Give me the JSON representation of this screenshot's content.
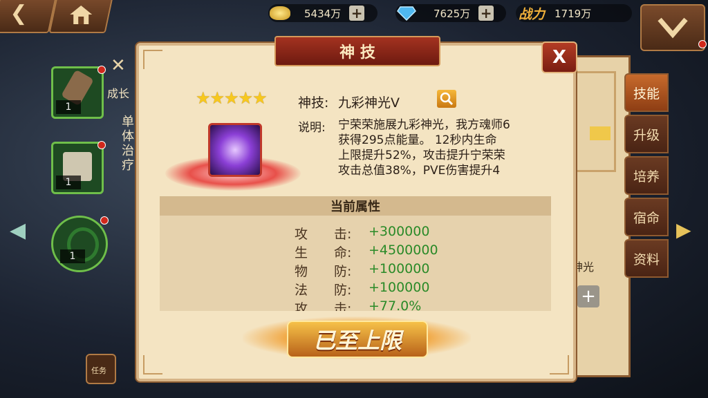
{
  "topbar": {
    "back_icon": "back-arrow-icon",
    "home_icon": "home-icon",
    "gold": {
      "icon": "gold-ingot-icon",
      "value": "5434万",
      "plus": "+"
    },
    "diamond": {
      "icon": "diamond-icon",
      "value": "7625万",
      "plus": "+"
    },
    "power": {
      "label": "战力",
      "value": "1719万"
    },
    "menu_icon": "chevron-down-menu-icon"
  },
  "left": {
    "slots": [
      {
        "count": "1"
      },
      {
        "count": "1"
      },
      {
        "count": "1"
      }
    ],
    "growth_label": "成长",
    "vertical_text": [
      "单",
      "体",
      "治",
      "疗"
    ],
    "task_label": "任务"
  },
  "right_tabs": [
    "技能",
    "升级",
    "培养",
    "宿命",
    "资料"
  ],
  "right_panel_fragment": "神光",
  "dialog": {
    "title": "神 技",
    "close": "X",
    "stars": 5,
    "skill_label": "神技:",
    "skill_name": "九彩神光V",
    "desc_label": "说明:",
    "desc_lines": [
      "宁荣荣施展九彩神光，我方魂师6",
      "获得295点能量。 12秒内生命",
      "上限提升52%，攻击提升宁荣荣",
      "攻击总值38%，PVE伤害提升4"
    ],
    "section_title": "当前属性",
    "attributes": [
      {
        "name": "攻　　击:",
        "value": "+300000"
      },
      {
        "name": "生　　命:",
        "value": "+4500000"
      },
      {
        "name": "物　　防:",
        "value": "+100000"
      },
      {
        "name": "法　　防:",
        "value": "+100000"
      },
      {
        "name": "攻　　击:",
        "value": "+77.0%"
      }
    ],
    "max_button": "已至上限"
  }
}
